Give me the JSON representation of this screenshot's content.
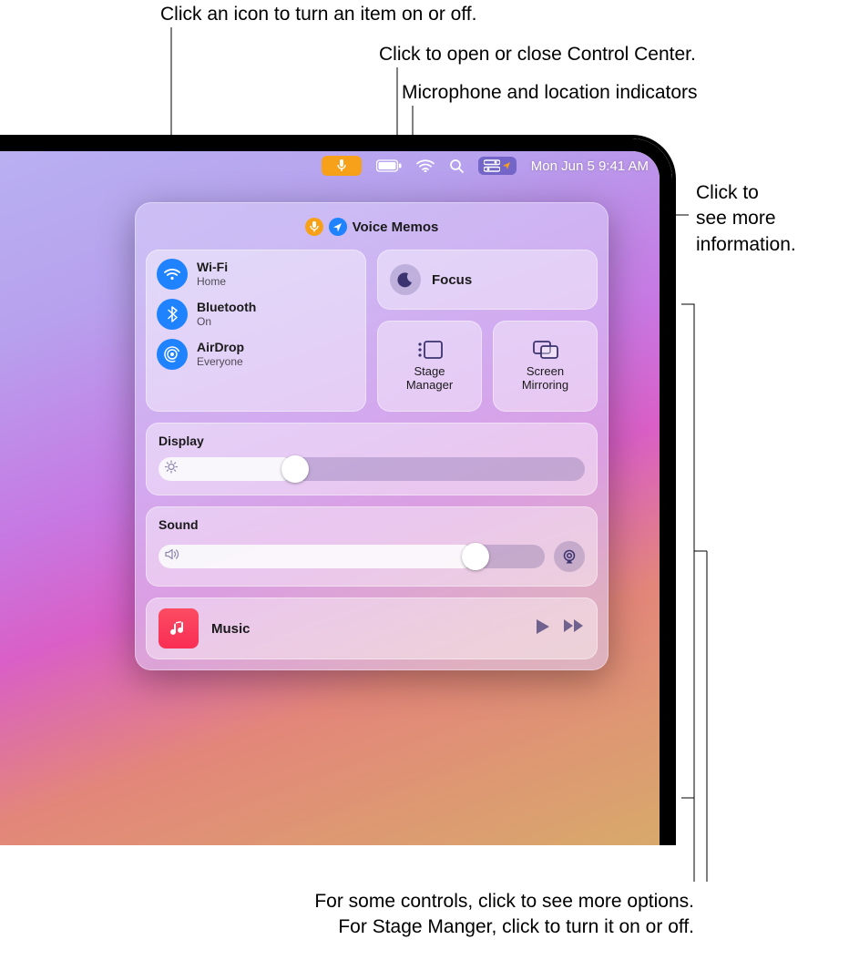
{
  "callouts": {
    "toggle": "Click an icon to turn an item on or off.",
    "openCC": "Click to open or close Control Center.",
    "micLoc": "Microphone and location indicators",
    "moreInfo1": "Click to",
    "moreInfo2": "see more",
    "moreInfo3": "information.",
    "optsLine1": "For some controls, click to see more options.",
    "optsLine2": "For Stage Manger, click to turn it on or off."
  },
  "menubar": {
    "datetime": "Mon Jun 5  9:41 AM"
  },
  "cc": {
    "headerApp": "Voice Memos",
    "wifi": {
      "title": "Wi-Fi",
      "sub": "Home"
    },
    "bluetooth": {
      "title": "Bluetooth",
      "sub": "On"
    },
    "airdrop": {
      "title": "AirDrop",
      "sub": "Everyone"
    },
    "focus": "Focus",
    "stageL1": "Stage",
    "stageL2": "Manager",
    "mirrorL1": "Screen",
    "mirrorL2": "Mirroring",
    "display": "Display",
    "sound": "Sound",
    "music": "Music",
    "displayPct": 32,
    "soundPct": 82
  }
}
